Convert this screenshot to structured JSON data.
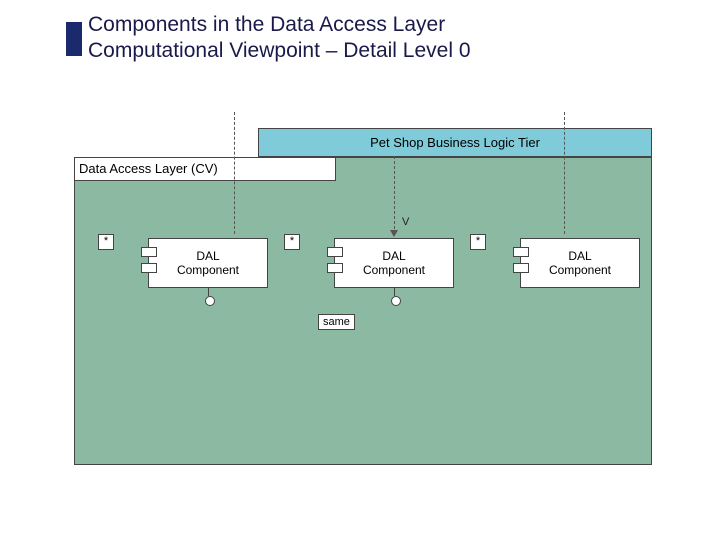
{
  "title": {
    "line1": "Components in the Data Access Layer",
    "line2": "Computational Viewpoint – Detail Level 0"
  },
  "diagram": {
    "top_header": "Pet Shop Business Logic Tier",
    "layer_label": "Data Access Layer (CV)",
    "arrow_label": "V",
    "note": "same",
    "star": "*",
    "component_label_line1": "DAL",
    "component_label_line2": "Component"
  }
}
